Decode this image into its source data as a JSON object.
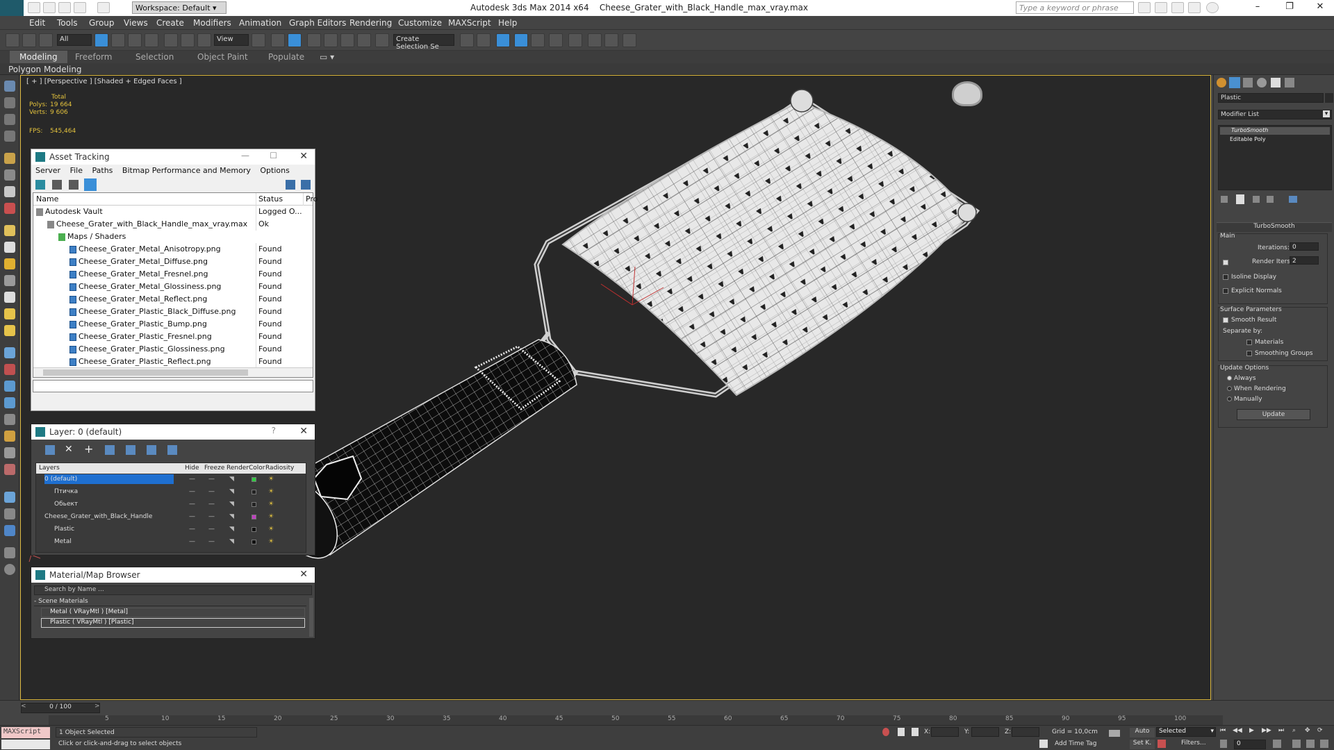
{
  "app": {
    "title": "Autodesk 3ds Max  2014 x64",
    "file": "Cheese_Grater_with_Black_Handle_max_vray.max",
    "workspace": "Workspace: Default",
    "search_placeholder": "Type a keyword or phrase"
  },
  "menu": [
    "Edit",
    "Tools",
    "Group",
    "Views",
    "Create",
    "Modifiers",
    "Animation",
    "Graph Editors",
    "Rendering",
    "Customize",
    "MAXScript",
    "Help"
  ],
  "toolbar": {
    "selection_filter": "All",
    "coord_system": "View",
    "selection_set": "Create Selection Se"
  },
  "ribbon": {
    "tabs": [
      "Modeling",
      "Freeform",
      "Selection",
      "Object Paint",
      "Populate"
    ],
    "active_tab": "Modeling",
    "sub_label": "Polygon Modeling"
  },
  "viewport": {
    "label": "[ + ] [Perspective ] [Shaded + Edged Faces ]",
    "stats_header": "Total",
    "polys_label": "Polys:",
    "polys_value": "19 664",
    "verts_label": "Verts:",
    "verts_value": "9 606",
    "fps_label": "FPS:",
    "fps_value": "545,464"
  },
  "asset_tracking": {
    "title": "Asset Tracking",
    "menu": [
      "Server",
      "File",
      "Paths",
      "Bitmap Performance and Memory",
      "Options"
    ],
    "columns": [
      "Name",
      "Status",
      "Pro"
    ],
    "rows": [
      {
        "name": "Autodesk Vault",
        "status": "Logged O...",
        "indent": 1,
        "icon": "vault"
      },
      {
        "name": "Cheese_Grater_with_Black_Handle_max_vray.max",
        "status": "Ok",
        "indent": 2,
        "icon": "file"
      },
      {
        "name": "Maps / Shaders",
        "status": "",
        "indent": 3,
        "icon": "maps"
      },
      {
        "name": "Cheese_Grater_Metal_Anisotropy.png",
        "status": "Found",
        "indent": 4,
        "icon": "image"
      },
      {
        "name": "Cheese_Grater_Metal_Diffuse.png",
        "status": "Found",
        "indent": 4,
        "icon": "image"
      },
      {
        "name": "Cheese_Grater_Metal_Fresnel.png",
        "status": "Found",
        "indent": 4,
        "icon": "image"
      },
      {
        "name": "Cheese_Grater_Metal_Glossiness.png",
        "status": "Found",
        "indent": 4,
        "icon": "image"
      },
      {
        "name": "Cheese_Grater_Metal_Reflect.png",
        "status": "Found",
        "indent": 4,
        "icon": "image"
      },
      {
        "name": "Cheese_Grater_Plastic_Black_Diffuse.png",
        "status": "Found",
        "indent": 4,
        "icon": "image"
      },
      {
        "name": "Cheese_Grater_Plastic_Bump.png",
        "status": "Found",
        "indent": 4,
        "icon": "image"
      },
      {
        "name": "Cheese_Grater_Plastic_Fresnel.png",
        "status": "Found",
        "indent": 4,
        "icon": "image"
      },
      {
        "name": "Cheese_Grater_Plastic_Glossiness.png",
        "status": "Found",
        "indent": 4,
        "icon": "image"
      },
      {
        "name": "Cheese_Grater_Plastic_Reflect.png",
        "status": "Found",
        "indent": 4,
        "icon": "image"
      }
    ]
  },
  "layer": {
    "title": "Layer: 0 (default)",
    "columns": [
      "Layers",
      "Hide",
      "Freeze",
      "Render",
      "Color",
      "Radiosity"
    ],
    "rows": [
      {
        "name": "0 (default)",
        "selected": true,
        "color": "#2ecc40"
      },
      {
        "name": "Птичка",
        "selected": false,
        "color": "#222222"
      },
      {
        "name": "Обьект",
        "selected": false,
        "color": "#222222"
      },
      {
        "name": "Cheese_Grater_with_Black_Handle",
        "selected": false,
        "color": "#c040c0"
      },
      {
        "name": "Plastic",
        "selected": false,
        "color": "#111111"
      },
      {
        "name": "Metal",
        "selected": false,
        "color": "#111111"
      }
    ]
  },
  "material_browser": {
    "title": "Material/Map Browser",
    "search_placeholder": "Search by Name ...",
    "group": "- Scene Materials",
    "items": [
      "Metal  ( VRayMtl )  [Metal]",
      "Plastic  ( VRayMtl )  [Plastic]"
    ]
  },
  "command_panel": {
    "object_name": "Plastic",
    "modifier_list": "Modifier List",
    "stack": [
      "TurboSmooth",
      "Editable Poly"
    ],
    "rollout_title": "TurboSmooth",
    "main_label": "Main",
    "iterations_label": "Iterations:",
    "iterations_value": "0",
    "render_iters_label": "Render Iters:",
    "render_iters_value": "2",
    "isoline": "Isoline Display",
    "explicit": "Explicit Normals",
    "surface_params": "Surface Parameters",
    "smooth_result": "Smooth Result",
    "separate_by": "Separate by:",
    "materials": "Materials",
    "smoothing_groups": "Smoothing Groups",
    "update_options": "Update Options",
    "always": "Always",
    "when_rendering": "When Rendering",
    "manually": "Manually",
    "update_btn": "Update"
  },
  "timeline": {
    "frame": "0 / 100",
    "ticks": [
      "5",
      "10",
      "15",
      "20",
      "25",
      "30",
      "35",
      "40",
      "45",
      "50",
      "55",
      "60",
      "65",
      "70",
      "75",
      "80",
      "85",
      "90",
      "95",
      "100"
    ]
  },
  "status": {
    "maxscript": "MAXScript",
    "selected": "1 Object Selected",
    "prompt": "Click or click-and-drag to select objects",
    "grid": "Grid = 10,0cm",
    "add_time_tag": "Add Time Tag",
    "auto": "Auto",
    "set_key": "Set K.",
    "key_mode": "Selected",
    "filters": "Filters...",
    "frame_field": "0",
    "x_label": "X:",
    "y_label": "Y:",
    "z_label": "Z:"
  }
}
